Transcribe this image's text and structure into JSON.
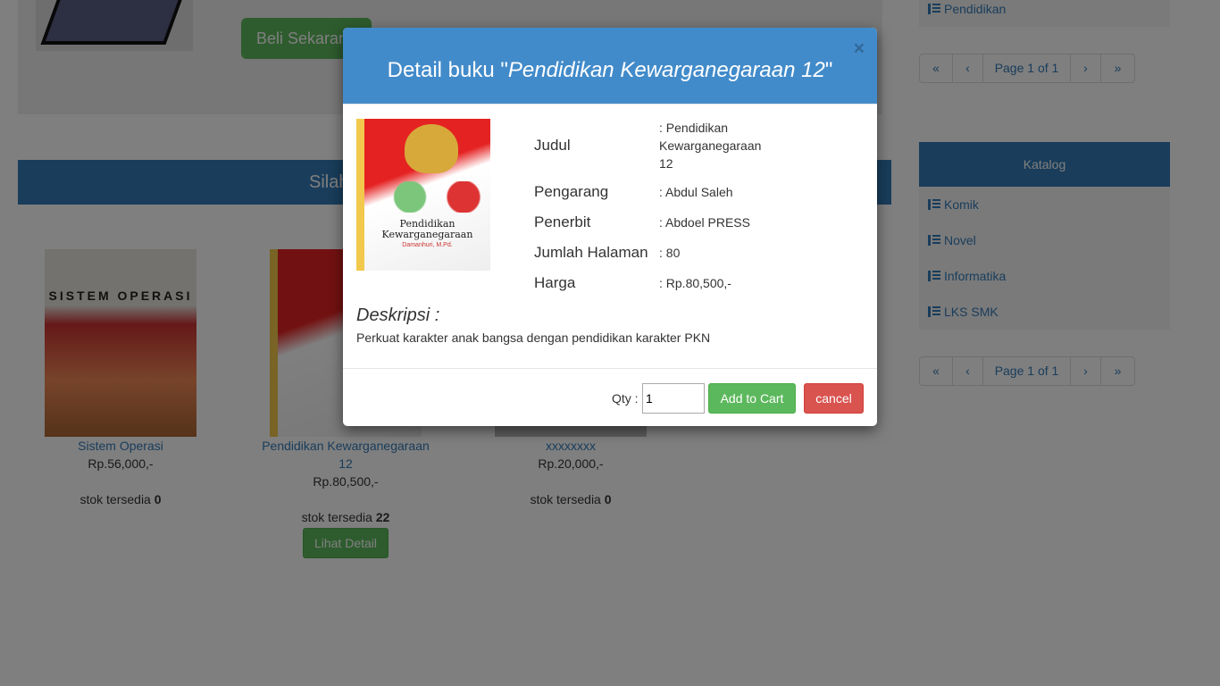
{
  "hero": {
    "buy_label": "Beli Sekarang"
  },
  "section_bar": {
    "title": "Silah"
  },
  "products": [
    {
      "title": "Sistem Operasi",
      "price": "Rp.56,000,-",
      "stock_label": "stok tersedia",
      "stock": "0",
      "cover_text": "SISTEM OPERASI"
    },
    {
      "title": "Pendidikan Kewarganegaraan 12",
      "price": "Rp.80,500,-",
      "stock_label": "stok tersedia",
      "stock": "22",
      "detail_label": "Lihat Detail"
    },
    {
      "title": "xxxxxxxx",
      "price": "Rp.20,000,-",
      "stock_label": "stok tersedia",
      "stock": "0"
    }
  ],
  "sidebar": {
    "top_item": "Pendidikan",
    "pager": {
      "first": "«",
      "prev": "‹",
      "page": "Page 1 of 1",
      "next": "›",
      "last": "»"
    },
    "katalog_title": "Katalog",
    "katalog_items": [
      "Komik",
      "Novel",
      "Informatika",
      "LKS SMK"
    ]
  },
  "modal": {
    "title_prefix": "Detail buku \"",
    "title_book": "Pendidikan Kewarganegaraan 12",
    "title_suffix": "\"",
    "close": "×",
    "cover": {
      "title": "Pendidikan Kewarganegaraan",
      "author": "Damanhuri, M.Pd."
    },
    "fields": [
      {
        "label": "Judul",
        "value": ": Pendidikan Kewarganegaraan 12"
      },
      {
        "label": "Pengarang",
        "value": ": Abdul Saleh"
      },
      {
        "label": "Penerbit",
        "value": ": Abdoel PRESS"
      },
      {
        "label": "Jumlah Halaman",
        "value": ": 80"
      },
      {
        "label": "Harga",
        "value": ": Rp.80,500,-"
      }
    ],
    "desc_heading": "Deskripsi :",
    "description": "Perkuat karakter anak bangsa dengan pendidikan karakter PKN",
    "qty_label": "Qty :",
    "qty_value": "1",
    "add_label": "Add to Cart",
    "cancel_label": "cancel"
  },
  "colors": {
    "primary": "#337ab7",
    "modal_header": "#428bca",
    "success": "#5cb85c",
    "danger": "#d9534f"
  }
}
